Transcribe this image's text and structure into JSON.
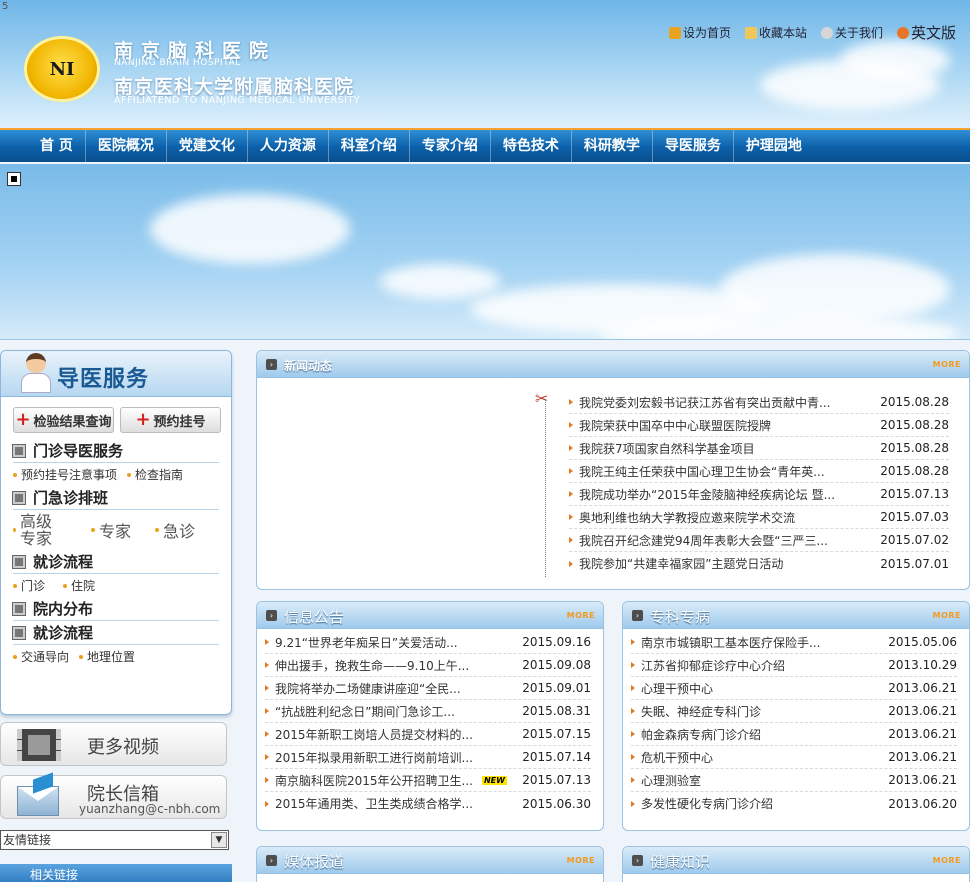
{
  "header": {
    "corner": "5",
    "logo_text": "NI",
    "name_cn": "南京脑科医院",
    "name_en": "NANJING BRAIN HOSPITAL",
    "name_cn2": "南京医科大学附属脑科医院",
    "name_en2": "AFFILIATEND TO NANJING MEDICAL UNIVERSITY",
    "toplinks": {
      "home": "设为首页",
      "favorite": "收藏本站",
      "about": "关于我们",
      "english": "英文版"
    }
  },
  "nav": [
    "首 页",
    "医院概况",
    "党建文化",
    "人力资源",
    "科室介绍",
    "专家介绍",
    "特色技术",
    "科研教学",
    "导医服务",
    "护理园地"
  ],
  "guide": {
    "title": "导医服务",
    "btn_results": "检验结果查询",
    "btn_appointment": "预约挂号",
    "sections": [
      {
        "title": "门诊导医服务",
        "links": [
          "预约挂号注意事项",
          "检查指南"
        ]
      },
      {
        "title": "门急诊排班",
        "links": [
          "高级专家",
          "专家",
          "急诊"
        ]
      },
      {
        "title": "就诊流程",
        "links": [
          "门诊",
          "住院"
        ]
      },
      {
        "title": "院内分布",
        "links": []
      },
      {
        "title": "就诊流程",
        "links": [
          "交通导向",
          "地理位置"
        ]
      }
    ]
  },
  "videos": {
    "label": "更多视频"
  },
  "mailbox": {
    "label": "院长信箱",
    "email": "yuanzhang@c-nbh.com"
  },
  "friend_links": {
    "selected": "友情链接"
  },
  "related": {
    "label": "相关链接"
  },
  "news": {
    "title": "新闻动态",
    "more": "MORE",
    "items": [
      {
        "text": "我院党委刘宏毅书记获江苏省有突出贡献中青...",
        "date": "2015.08.28"
      },
      {
        "text": "我院荣获中国卒中中心联盟医院授牌",
        "date": "2015.08.28"
      },
      {
        "text": "我院获7项国家自然科学基金项目",
        "date": "2015.08.28"
      },
      {
        "text": "我院王纯主任荣获中国心理卫生协会“青年英...",
        "date": "2015.08.28"
      },
      {
        "text": "我院成功举办“2015年金陵脑神经疾病论坛 暨...",
        "date": "2015.07.13"
      },
      {
        "text": "奥地利维也纳大学教授应邀来院学术交流",
        "date": "2015.07.03"
      },
      {
        "text": "我院召开纪念建党94周年表彰大会暨“三严三...",
        "date": "2015.07.02"
      },
      {
        "text": "我院参加“共建幸福家园”主题党日活动",
        "date": "2015.07.01"
      }
    ]
  },
  "notice": {
    "title": "信息公告",
    "more": "MORE",
    "items": [
      {
        "text": "9.21“世界老年痴呆日”关爱活动...",
        "date": "2015.09.16"
      },
      {
        "text": "伸出援手，挽救生命——9.10上午...",
        "date": "2015.09.08"
      },
      {
        "text": "我院将举办二场健康讲座迎“全民...",
        "date": "2015.09.01"
      },
      {
        "text": "“抗战胜利纪念日”期间门急诊工...",
        "date": "2015.08.31"
      },
      {
        "text": "2015年新职工岗培人员提交材料的...",
        "date": "2015.07.15"
      },
      {
        "text": "2015年拟录用新职工进行岗前培训...",
        "date": "2015.07.14"
      },
      {
        "text": "南京脑科医院2015年公开招聘卫生...",
        "date": "2015.07.13",
        "badge": "NEW"
      },
      {
        "text": "2015年通用类、卫生类成绩合格学...",
        "date": "2015.06.30"
      }
    ]
  },
  "special": {
    "title": "专科专病",
    "more": "MORE",
    "items": [
      {
        "text": "南京市城镇职工基本医疗保险手...",
        "date": "2015.05.06"
      },
      {
        "text": "江苏省抑郁症诊疗中心介绍",
        "date": "2013.10.29"
      },
      {
        "text": "心理干预中心",
        "date": "2013.06.21"
      },
      {
        "text": "失眠、神经症专科门诊",
        "date": "2013.06.21"
      },
      {
        "text": "帕金森病专病门诊介绍",
        "date": "2013.06.21"
      },
      {
        "text": "危机干预中心",
        "date": "2013.06.21"
      },
      {
        "text": "心理测验室",
        "date": "2013.06.21"
      },
      {
        "text": "多发性硬化专病门诊介绍",
        "date": "2013.06.20"
      }
    ]
  },
  "media": {
    "title": "媒体报道",
    "more": "MORE"
  },
  "health": {
    "title": "健康知识",
    "more": "MORE"
  }
}
